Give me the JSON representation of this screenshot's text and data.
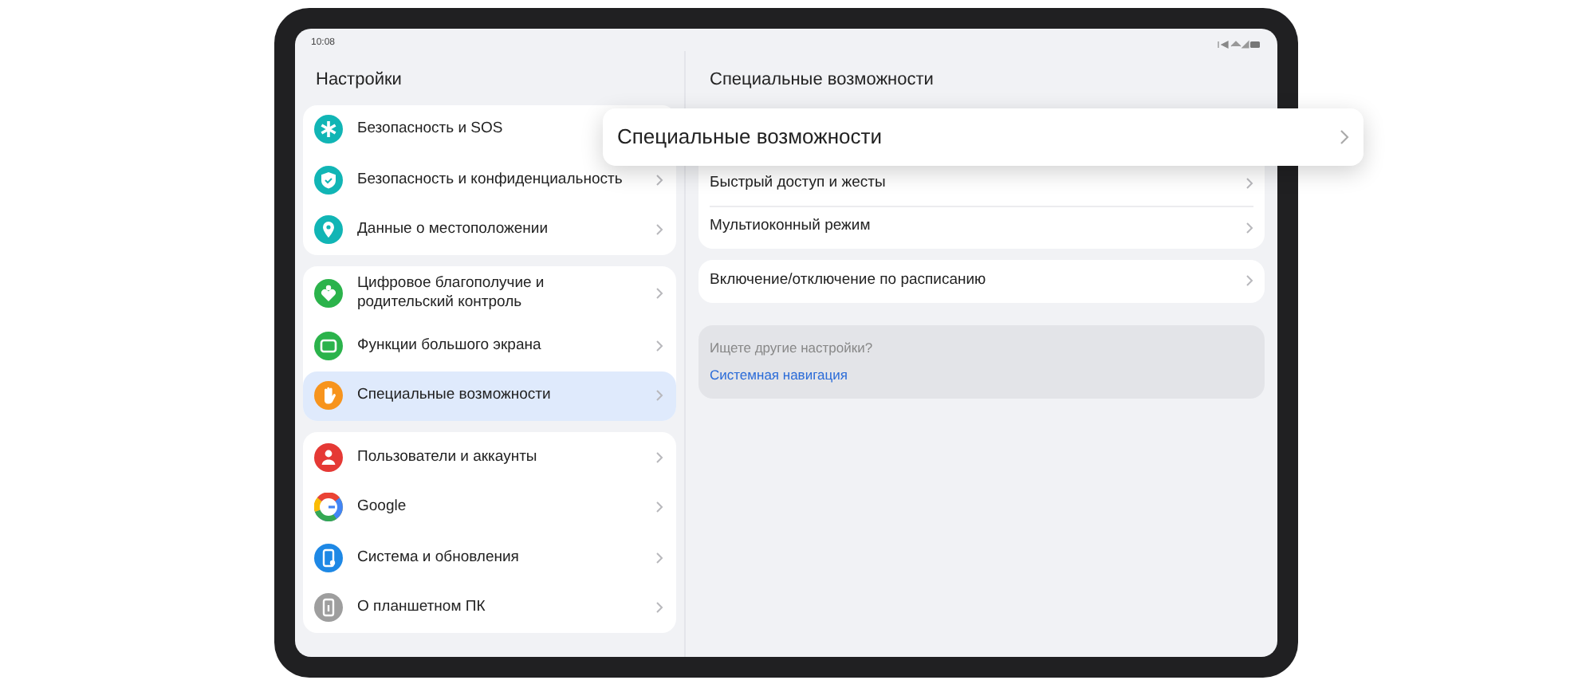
{
  "status_bar": {
    "time": "10:08"
  },
  "sidebar": {
    "title": "Настройки",
    "groups": [
      {
        "items": [
          {
            "label": "Безопасность и SOS",
            "kind": "sos",
            "selected": false
          },
          {
            "label": "Безопасность и конфиденциальность",
            "kind": "shield",
            "selected": false
          },
          {
            "label": "Данные о местоположении",
            "kind": "location",
            "selected": false
          }
        ]
      },
      {
        "items": [
          {
            "label": "Цифровое благополучие и родительский контроль",
            "kind": "wellbeing",
            "selected": false
          },
          {
            "label": "Функции большого экрана",
            "kind": "screen",
            "selected": false
          },
          {
            "label": "Специальные возможности",
            "kind": "hand",
            "selected": true
          }
        ]
      },
      {
        "items": [
          {
            "label": "Пользователи и аккаунты",
            "kind": "user",
            "selected": false
          },
          {
            "label": "Google",
            "kind": "google",
            "selected": false
          },
          {
            "label": "Система и обновления",
            "kind": "system",
            "selected": false
          },
          {
            "label": "О планшетном ПК",
            "kind": "about",
            "selected": false
          }
        ]
      }
    ]
  },
  "detail": {
    "title": "Специальные возможности",
    "groups": [
      {
        "covered_top": true,
        "items": [
          "Быстрый доступ и жесты",
          "Мультиоконный режим"
        ]
      },
      {
        "covered_top": false,
        "items": [
          "Включение/отключение по расписанию"
        ]
      }
    ],
    "suggestion": {
      "question": "Ищете другие настройки?",
      "link": "Системная навигация"
    }
  },
  "popup": {
    "label": "Специальные возможности"
  }
}
